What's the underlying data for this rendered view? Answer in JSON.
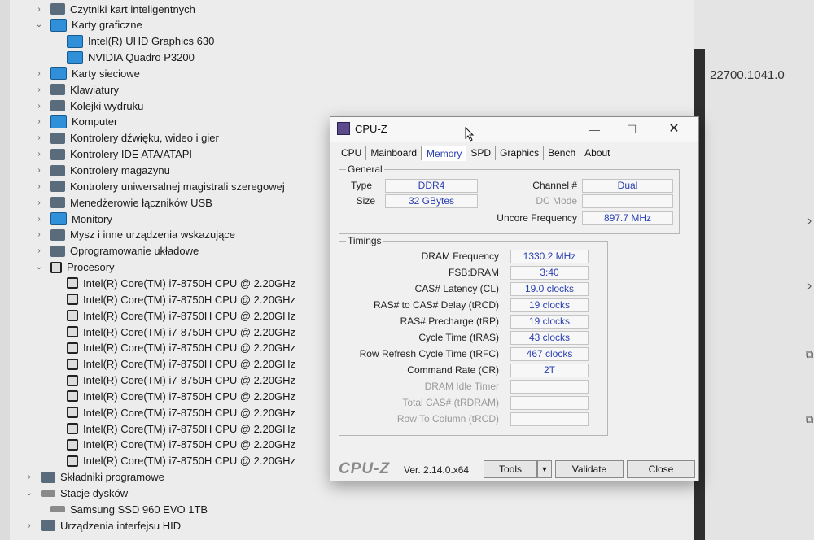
{
  "devmgr": {
    "items": [
      {
        "label": "Czytniki kart inteligentnych",
        "chev": "›",
        "icon": "smartcard-icon",
        "indent": 1
      },
      {
        "label": "Karty graficzne",
        "chev": "⌄",
        "icon": "display-adapter-icon",
        "indent": 1
      },
      {
        "label": "Intel(R) UHD Graphics 630",
        "chev": "",
        "icon": "gpu-icon",
        "indent": 2
      },
      {
        "label": "NVIDIA Quadro P3200",
        "chev": "",
        "icon": "gpu-icon",
        "indent": 2
      },
      {
        "label": "Karty sieciowe",
        "chev": "›",
        "icon": "network-icon",
        "indent": 1
      },
      {
        "label": "Klawiatury",
        "chev": "›",
        "icon": "keyboard-icon",
        "indent": 1
      },
      {
        "label": "Kolejki wydruku",
        "chev": "›",
        "icon": "printer-icon",
        "indent": 1
      },
      {
        "label": "Komputer",
        "chev": "›",
        "icon": "computer-icon",
        "indent": 1
      },
      {
        "label": "Kontrolery dźwięku, wideo i gier",
        "chev": "›",
        "icon": "speaker-icon",
        "indent": 1
      },
      {
        "label": "Kontrolery IDE ATA/ATAPI",
        "chev": "›",
        "icon": "ide-icon",
        "indent": 1
      },
      {
        "label": "Kontrolery magazynu",
        "chev": "›",
        "icon": "storage-icon",
        "indent": 1
      },
      {
        "label": "Kontrolery uniwersalnej magistrali szeregowej",
        "chev": "›",
        "icon": "usb-icon",
        "indent": 1
      },
      {
        "label": "Menedżerowie łączników USB",
        "chev": "›",
        "icon": "usb-icon",
        "indent": 1
      },
      {
        "label": "Monitory",
        "chev": "›",
        "icon": "monitor-icon",
        "indent": 1
      },
      {
        "label": "Mysz i inne urządzenia wskazujące",
        "chev": "›",
        "icon": "mouse-icon",
        "indent": 1
      },
      {
        "label": "Oprogramowanie układowe",
        "chev": "›",
        "icon": "firmware-icon",
        "indent": 1
      },
      {
        "label": "Procesory",
        "chev": "⌄",
        "icon": "cpu-icon",
        "indent": 1
      },
      {
        "label": "Intel(R) Core(TM) i7-8750H CPU @ 2.20GHz",
        "chev": "",
        "icon": "cpu-icon",
        "indent": 2
      },
      {
        "label": "Intel(R) Core(TM) i7-8750H CPU @ 2.20GHz",
        "chev": "",
        "icon": "cpu-icon",
        "indent": 2
      },
      {
        "label": "Intel(R) Core(TM) i7-8750H CPU @ 2.20GHz",
        "chev": "",
        "icon": "cpu-icon",
        "indent": 2
      },
      {
        "label": "Intel(R) Core(TM) i7-8750H CPU @ 2.20GHz",
        "chev": "",
        "icon": "cpu-icon",
        "indent": 2
      },
      {
        "label": "Intel(R) Core(TM) i7-8750H CPU @ 2.20GHz",
        "chev": "",
        "icon": "cpu-icon",
        "indent": 2
      },
      {
        "label": "Intel(R) Core(TM) i7-8750H CPU @ 2.20GHz",
        "chev": "",
        "icon": "cpu-icon",
        "indent": 2
      },
      {
        "label": "Intel(R) Core(TM) i7-8750H CPU @ 2.20GHz",
        "chev": "",
        "icon": "cpu-icon",
        "indent": 2
      },
      {
        "label": "Intel(R) Core(TM) i7-8750H CPU @ 2.20GHz",
        "chev": "",
        "icon": "cpu-icon",
        "indent": 2
      },
      {
        "label": "Intel(R) Core(TM) i7-8750H CPU @ 2.20GHz",
        "chev": "",
        "icon": "cpu-icon",
        "indent": 2
      },
      {
        "label": "Intel(R) Core(TM) i7-8750H CPU @ 2.20GHz",
        "chev": "",
        "icon": "cpu-icon",
        "indent": 2
      },
      {
        "label": "Intel(R) Core(TM) i7-8750H CPU @ 2.20GHz",
        "chev": "",
        "icon": "cpu-icon",
        "indent": 2
      },
      {
        "label": "Intel(R) Core(TM) i7-8750H CPU @ 2.20GHz",
        "chev": "",
        "icon": "cpu-icon",
        "indent": 2
      },
      {
        "label": "Składniki programowe",
        "chev": "›",
        "icon": "software-component-icon",
        "indent": 0
      },
      {
        "label": "Stacje dysków",
        "chev": "⌄",
        "icon": "disk-drive-icon",
        "indent": 0
      },
      {
        "label": "Samsung SSD 960 EVO 1TB",
        "chev": "",
        "icon": "disk-drive-icon",
        "indent": 1
      },
      {
        "label": "Urządzenia interfejsu HID",
        "chev": "›",
        "icon": "hid-icon",
        "indent": 0
      }
    ]
  },
  "right_panel": {
    "build_text": "22700.1041.0",
    "chevron": "›",
    "external": "⧉"
  },
  "cpuz": {
    "title": "CPU-Z",
    "window_buttons": {
      "minimize": "—",
      "maximize": "☐",
      "close": "✕"
    },
    "tabs": [
      "CPU",
      "Mainboard",
      "Memory",
      "SPD",
      "Graphics",
      "Bench",
      "About"
    ],
    "active_tab": "Memory",
    "general": {
      "title": "General",
      "type_label": "Type",
      "type_value": "DDR4",
      "size_label": "Size",
      "size_value": "32 GBytes",
      "channel_label": "Channel #",
      "channel_value": "Dual",
      "dcmode_label": "DC Mode",
      "dcmode_value": "",
      "uncore_label": "Uncore Frequency",
      "uncore_value": "897.7 MHz"
    },
    "timings": {
      "title": "Timings",
      "rows": [
        {
          "label": "DRAM Frequency",
          "value": "1330.2 MHz",
          "dim": false
        },
        {
          "label": "FSB:DRAM",
          "value": "3:40",
          "dim": false
        },
        {
          "label": "CAS# Latency (CL)",
          "value": "19.0 clocks",
          "dim": false
        },
        {
          "label": "RAS# to CAS# Delay (tRCD)",
          "value": "19 clocks",
          "dim": false
        },
        {
          "label": "RAS# Precharge (tRP)",
          "value": "19 clocks",
          "dim": false
        },
        {
          "label": "Cycle Time (tRAS)",
          "value": "43 clocks",
          "dim": false
        },
        {
          "label": "Row Refresh Cycle Time (tRFC)",
          "value": "467 clocks",
          "dim": false
        },
        {
          "label": "Command Rate (CR)",
          "value": "2T",
          "dim": false
        },
        {
          "label": "DRAM Idle Timer",
          "value": "",
          "dim": true
        },
        {
          "label": "Total CAS# (tRDRAM)",
          "value": "",
          "dim": true
        },
        {
          "label": "Row To Column (tRCD)",
          "value": "",
          "dim": true
        }
      ]
    },
    "bottom": {
      "logo": "CPU-Z",
      "version": "Ver. 2.14.0.x64",
      "tools_label": "Tools",
      "dropdown_glyph": "▼",
      "validate_label": "Validate",
      "close_label": "Close"
    }
  }
}
